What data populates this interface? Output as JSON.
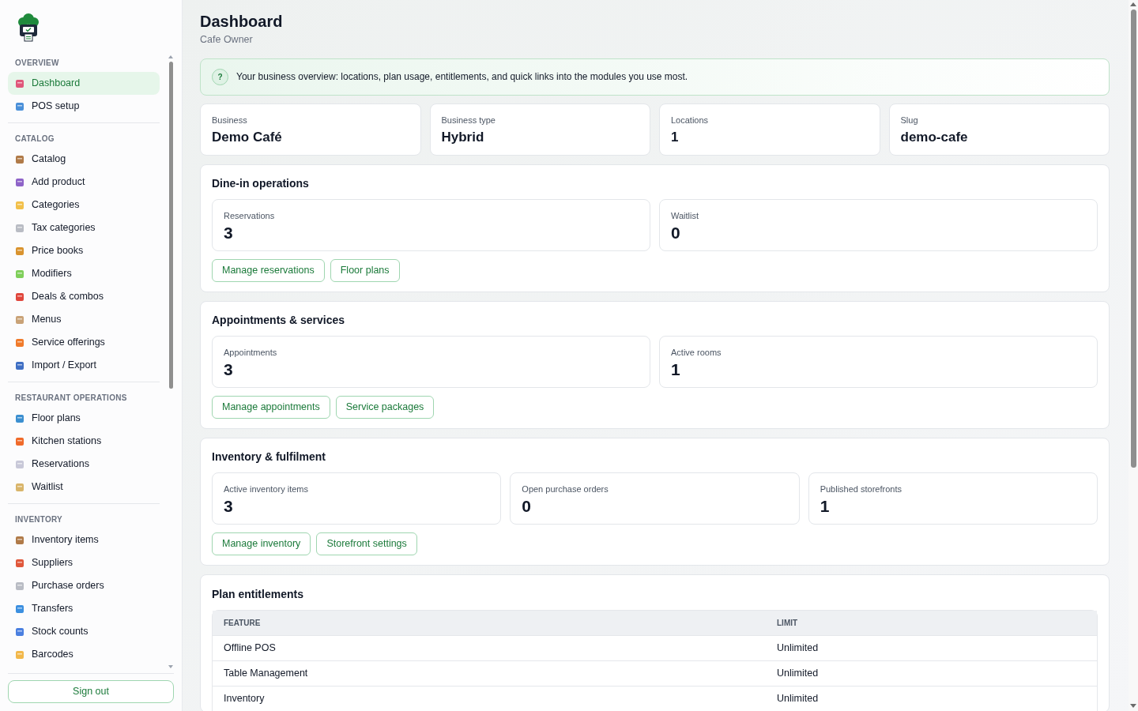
{
  "sidebar": {
    "sections": [
      {
        "title": "OVERVIEW",
        "items": [
          {
            "label": "Dashboard",
            "selected": true
          },
          {
            "label": "POS setup",
            "selected": false
          }
        ]
      },
      {
        "title": "CATALOG",
        "items": [
          {
            "label": "Catalog",
            "selected": false
          },
          {
            "label": "Add product",
            "selected": false
          },
          {
            "label": "Categories",
            "selected": false
          },
          {
            "label": "Tax categories",
            "selected": false
          },
          {
            "label": "Price books",
            "selected": false
          },
          {
            "label": "Modifiers",
            "selected": false
          },
          {
            "label": "Deals & combos",
            "selected": false
          },
          {
            "label": "Menus",
            "selected": false
          },
          {
            "label": "Service offerings",
            "selected": false
          },
          {
            "label": "Import / Export",
            "selected": false
          }
        ]
      },
      {
        "title": "RESTAURANT OPERATIONS",
        "items": [
          {
            "label": "Floor plans",
            "selected": false
          },
          {
            "label": "Kitchen stations",
            "selected": false
          },
          {
            "label": "Reservations",
            "selected": false
          },
          {
            "label": "Waitlist",
            "selected": false
          }
        ]
      },
      {
        "title": "INVENTORY",
        "items": [
          {
            "label": "Inventory items",
            "selected": false
          },
          {
            "label": "Suppliers",
            "selected": false
          },
          {
            "label": "Purchase orders",
            "selected": false
          },
          {
            "label": "Transfers",
            "selected": false
          },
          {
            "label": "Stock counts",
            "selected": false
          },
          {
            "label": "Barcodes",
            "selected": false
          }
        ]
      }
    ],
    "sign_out": "Sign out"
  },
  "header": {
    "title": "Dashboard",
    "subtitle": "Cafe Owner"
  },
  "info": {
    "icon": "?",
    "text": "Your business overview: locations, plan usage, entitlements, and quick links into the modules you use most."
  },
  "summary": [
    {
      "label": "Business",
      "value": "Demo Café"
    },
    {
      "label": "Business type",
      "value": "Hybrid"
    },
    {
      "label": "Locations",
      "value": "1"
    },
    {
      "label": "Slug",
      "value": "demo-cafe"
    }
  ],
  "modules": [
    {
      "title": "Dine-in operations",
      "stats": [
        {
          "label": "Reservations",
          "value": "3"
        },
        {
          "label": "Waitlist",
          "value": "0"
        }
      ],
      "links": [
        "Manage reservations",
        "Floor plans"
      ]
    },
    {
      "title": "Appointments & services",
      "stats": [
        {
          "label": "Appointments",
          "value": "3"
        },
        {
          "label": "Active rooms",
          "value": "1"
        }
      ],
      "links": [
        "Manage appointments",
        "Service packages"
      ]
    },
    {
      "title": "Inventory & fulfilment",
      "stats": [
        {
          "label": "Active inventory items",
          "value": "3"
        },
        {
          "label": "Open purchase orders",
          "value": "0"
        },
        {
          "label": "Published storefronts",
          "value": "1"
        }
      ],
      "links": [
        "Manage inventory",
        "Storefront settings"
      ]
    }
  ],
  "entitlements": {
    "title": "Plan entitlements",
    "columns": [
      "FEATURE",
      "LIMIT"
    ],
    "rows": [
      [
        "Offline POS",
        "Unlimited"
      ],
      [
        "Table Management",
        "Unlimited"
      ],
      [
        "Inventory",
        "Unlimited"
      ]
    ]
  }
}
